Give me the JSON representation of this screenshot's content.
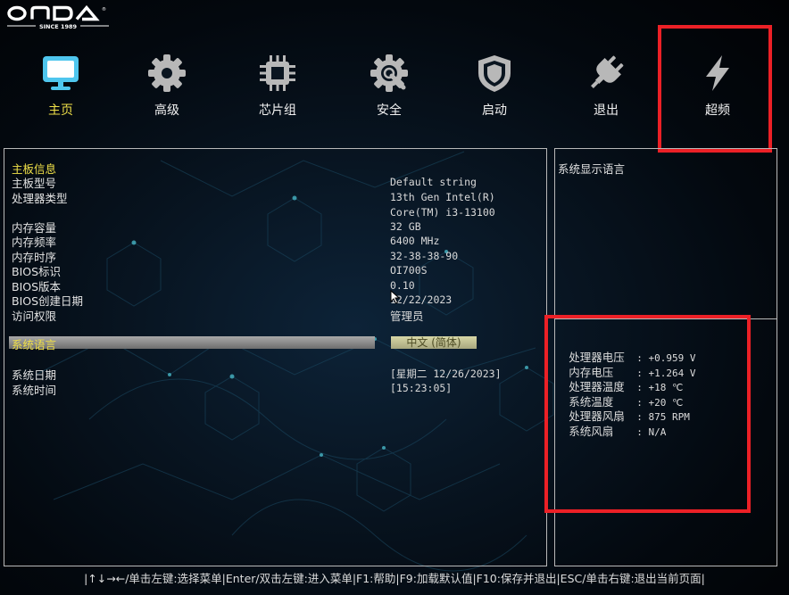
{
  "logo": {
    "brand": "ONDA",
    "tagline": "SINCE 1989"
  },
  "nav": {
    "items": [
      {
        "label": "主页",
        "icon": "monitor-icon",
        "active": true
      },
      {
        "label": "高级",
        "icon": "gear-icon"
      },
      {
        "label": "芯片组",
        "icon": "chip-icon"
      },
      {
        "label": "安全",
        "icon": "security-gear-icon"
      },
      {
        "label": "启动",
        "icon": "shield-icon"
      },
      {
        "label": "退出",
        "icon": "plug-icon"
      },
      {
        "label": "超频",
        "icon": "lightning-icon"
      }
    ]
  },
  "main": {
    "section_title": "主板信息",
    "rows": [
      {
        "label": "主板型号",
        "value": "Default string"
      },
      {
        "label": "处理器类型",
        "value": "13th Gen Intel(R)",
        "value2": "Core(TM) i3-13100"
      },
      {
        "label": "内存容量",
        "value": "32 GB"
      },
      {
        "label": "内存频率",
        "value": "6400 MHz"
      },
      {
        "label": "内存时序",
        "value": "32-38-38-90"
      },
      {
        "label": "BIOS标识",
        "value": "OI700S"
      },
      {
        "label": "BIOS版本",
        "value": "0.10"
      },
      {
        "label": "BIOS创建日期",
        "value": "12/22/2023"
      },
      {
        "label": "访问权限",
        "value": "管理员"
      }
    ],
    "language": {
      "label": "系统语言",
      "value": "中文 (简体)"
    },
    "date": {
      "label": "系统日期",
      "value": "[星期二 12/26/2023]"
    },
    "time": {
      "label": "系统时间",
      "value": "[15:23:05]"
    }
  },
  "help_panel": {
    "text": "系统显示语言"
  },
  "status": [
    {
      "key": "处理器电压",
      "value": ": +0.959 V"
    },
    {
      "key": "内存电压",
      "value": ": +1.264 V"
    },
    {
      "key": "处理器温度",
      "value": ": +18 ℃"
    },
    {
      "key": "系统温度",
      "value": ": +20 ℃"
    },
    {
      "key": "处理器风扇",
      "value": ": 875 RPM"
    },
    {
      "key": "系统风扇",
      "value": ": N/A"
    }
  ],
  "footer": {
    "text": "|↑↓→←/单击左键:选择菜单|Enter/双击左键:进入菜单|F1:帮助|F9:加载默认值|F10:保存并退出|ESC/单击右键:退出当前页面|"
  },
  "colors": {
    "highlight": "#f0e048",
    "annotation_red": "#ec2026",
    "icon_active": "#4fc6ee",
    "icon_inactive": "#b8b8b8"
  }
}
